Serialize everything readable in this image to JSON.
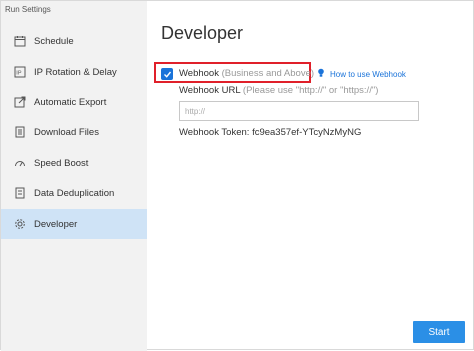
{
  "window": {
    "title": "Run Settings"
  },
  "sidebar": {
    "items": [
      {
        "label": "Schedule",
        "icon": "calendar-icon"
      },
      {
        "label": "IP Rotation & Delay",
        "icon": "ip-icon"
      },
      {
        "label": "Automatic Export",
        "icon": "export-icon"
      },
      {
        "label": "Download Files",
        "icon": "download-icon"
      },
      {
        "label": "Speed Boost",
        "icon": "speed-icon"
      },
      {
        "label": "Data Deduplication",
        "icon": "deduplication-icon"
      },
      {
        "label": "Developer",
        "icon": "gear-icon",
        "active": true
      }
    ]
  },
  "main": {
    "title": "Developer",
    "webhook": {
      "checked": true,
      "label": "Webhook",
      "note": "(Business and Above)",
      "help_link": "How to use Webhook"
    },
    "url": {
      "label": "Webhook URL",
      "note": "(Please use \"http://\" or \"https://\")",
      "placeholder": "http://",
      "value": ""
    },
    "token": {
      "label": "Webhook Token:",
      "value": "fc9ea357ef-YTcyNzMyNG"
    }
  },
  "footer": {
    "start_label": "Start"
  },
  "colors": {
    "accent": "#1a73d9",
    "button": "#2b8fe6",
    "active_nav": "#cfe3f6",
    "highlight": "#e0202a"
  }
}
